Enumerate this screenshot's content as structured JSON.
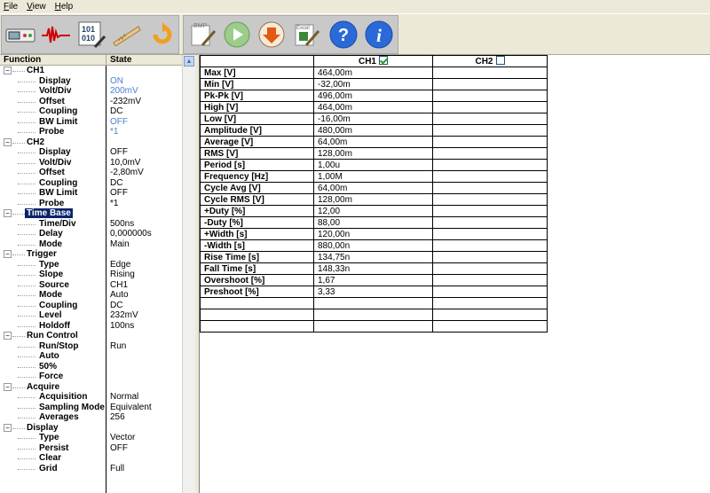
{
  "menu": [
    {
      "first": "F",
      "rest": "ile"
    },
    {
      "first": "V",
      "rest": "iew"
    },
    {
      "first": "H",
      "rest": "elp"
    }
  ],
  "toolbar": {
    "buttons": [
      {
        "name": "scope-display-icon"
      },
      {
        "name": "waveform-icon"
      },
      {
        "name": "binary-data-icon"
      },
      {
        "name": "measure-icon"
      },
      {
        "name": "refresh-icon"
      },
      {
        "name": "bmp-export-icon",
        "label": "BMP"
      },
      {
        "name": "run-icon"
      },
      {
        "name": "download-icon"
      },
      {
        "name": "excel-export-icon",
        "label": "Excel"
      },
      {
        "name": "help-icon",
        "label": "?"
      },
      {
        "name": "info-icon",
        "label": "i"
      }
    ]
  },
  "tree": {
    "header": {
      "function": "Function",
      "state": "State"
    },
    "rows": [
      {
        "label": "CH1",
        "level": 1,
        "expander": true
      },
      {
        "label": "Display",
        "level": 2,
        "value": "ON",
        "blue": true
      },
      {
        "label": "Volt/Div",
        "level": 2,
        "value": "200mV",
        "blue": true
      },
      {
        "label": "Offset",
        "level": 2,
        "value": "-232mV"
      },
      {
        "label": "Coupling",
        "level": 2,
        "value": "DC"
      },
      {
        "label": "BW Limit",
        "level": 2,
        "value": "OFF",
        "blue": true
      },
      {
        "label": "Probe",
        "level": 2,
        "value": "*1",
        "blue": true
      },
      {
        "label": "CH2",
        "level": 1,
        "expander": true
      },
      {
        "label": "Display",
        "level": 2,
        "value": "OFF"
      },
      {
        "label": "Volt/Div",
        "level": 2,
        "value": "10,0mV"
      },
      {
        "label": "Offset",
        "level": 2,
        "value": "-2,80mV"
      },
      {
        "label": "Coupling",
        "level": 2,
        "value": "DC"
      },
      {
        "label": "BW Limit",
        "level": 2,
        "value": "OFF"
      },
      {
        "label": "Probe",
        "level": 2,
        "value": "*1"
      },
      {
        "label": "Time Base",
        "level": 1,
        "expander": true,
        "selected": true
      },
      {
        "label": "Time/Div",
        "level": 2,
        "value": "500ns"
      },
      {
        "label": "Delay",
        "level": 2,
        "value": "0,000000s"
      },
      {
        "label": "Mode",
        "level": 2,
        "value": "Main"
      },
      {
        "label": "Trigger",
        "level": 1,
        "expander": true
      },
      {
        "label": "Type",
        "level": 2,
        "value": "Edge"
      },
      {
        "label": "Slope",
        "level": 2,
        "value": "Rising"
      },
      {
        "label": "Source",
        "level": 2,
        "value": "CH1"
      },
      {
        "label": "Mode",
        "level": 2,
        "value": "Auto"
      },
      {
        "label": "Coupling",
        "level": 2,
        "value": "DC"
      },
      {
        "label": "Level",
        "level": 2,
        "value": "232mV"
      },
      {
        "label": "Holdoff",
        "level": 2,
        "value": "100ns"
      },
      {
        "label": "Run Control",
        "level": 1,
        "expander": true
      },
      {
        "label": "Run/Stop",
        "level": 2,
        "value": "Run"
      },
      {
        "label": "Auto",
        "level": 2,
        "value": ""
      },
      {
        "label": "50%",
        "level": 2,
        "value": ""
      },
      {
        "label": "Force",
        "level": 2,
        "value": ""
      },
      {
        "label": "Acquire",
        "level": 1,
        "expander": true
      },
      {
        "label": "Acquisition",
        "level": 2,
        "value": "Normal"
      },
      {
        "label": "Sampling Mode",
        "level": 2,
        "value": "Equivalent"
      },
      {
        "label": "Averages",
        "level": 2,
        "value": "256"
      },
      {
        "label": "Display",
        "level": 1,
        "expander": true
      },
      {
        "label": "Type",
        "level": 2,
        "value": "Vector"
      },
      {
        "label": "Persist",
        "level": 2,
        "value": "OFF"
      },
      {
        "label": "Clear",
        "level": 2,
        "value": ""
      },
      {
        "label": "Grid",
        "level": 2,
        "value": "Full"
      }
    ]
  },
  "measure_grid": {
    "ch1_header": "CH1",
    "ch2_header": "CH2",
    "ch1_checked": true,
    "ch2_checked": false,
    "rows": [
      {
        "label": "Max [V]",
        "ch1": "464,00m",
        "ch2": ""
      },
      {
        "label": "Min [V]",
        "ch1": "-32,00m",
        "ch2": ""
      },
      {
        "label": "Pk-Pk [V]",
        "ch1": "496,00m",
        "ch2": ""
      },
      {
        "label": "High [V]",
        "ch1": "464,00m",
        "ch2": ""
      },
      {
        "label": "Low [V]",
        "ch1": "-16,00m",
        "ch2": ""
      },
      {
        "label": "Amplitude [V]",
        "ch1": "480,00m",
        "ch2": ""
      },
      {
        "label": "Average [V]",
        "ch1": "64,00m",
        "ch2": ""
      },
      {
        "label": "RMS [V]",
        "ch1": "128,00m",
        "ch2": ""
      },
      {
        "label": "Period [s]",
        "ch1": "1,00u",
        "ch2": ""
      },
      {
        "label": "Frequency [Hz]",
        "ch1": "1,00M",
        "ch2": ""
      },
      {
        "label": "Cycle Avg [V]",
        "ch1": "64,00m",
        "ch2": ""
      },
      {
        "label": "Cycle RMS [V]",
        "ch1": "128,00m",
        "ch2": ""
      },
      {
        "label": "+Duty [%]",
        "ch1": "12,00",
        "ch2": ""
      },
      {
        "label": "-Duty [%]",
        "ch1": "88,00",
        "ch2": ""
      },
      {
        "label": "+Width [s]",
        "ch1": "120,00n",
        "ch2": ""
      },
      {
        "label": "-Width [s]",
        "ch1": "880,00n",
        "ch2": ""
      },
      {
        "label": "Rise Time [s]",
        "ch1": "134,75n",
        "ch2": ""
      },
      {
        "label": "Fall Time [s]",
        "ch1": "148,33n",
        "ch2": ""
      },
      {
        "label": "Overshoot [%]",
        "ch1": " 1,67",
        "ch2": ""
      },
      {
        "label": "Preshoot [%]",
        "ch1": " 3,33",
        "ch2": ""
      },
      {
        "label": "",
        "ch1": "",
        "ch2": ""
      },
      {
        "label": "",
        "ch1": "",
        "ch2": ""
      },
      {
        "label": "",
        "ch1": "",
        "ch2": ""
      }
    ]
  }
}
